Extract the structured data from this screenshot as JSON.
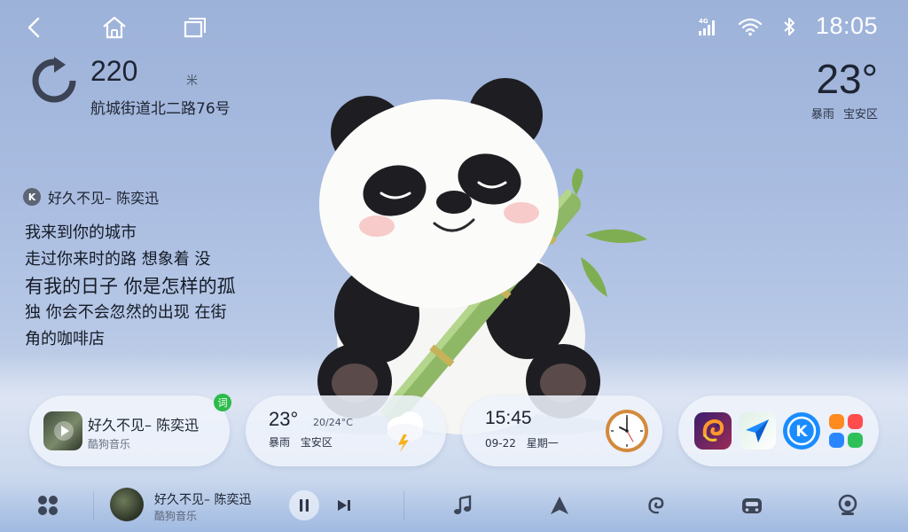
{
  "status": {
    "clock": "18:05",
    "network": "4G"
  },
  "navigation": {
    "distance": "220",
    "unit": "米",
    "road": "航城街道北二路76号"
  },
  "weather_top": {
    "temperature": "23°",
    "condition": "暴雨",
    "district": "宝安区"
  },
  "lyrics": {
    "badge": "K",
    "song_title": "好久不见– 陈奕迅",
    "lines": [
      "我来到你的城市",
      "走过你来时的路 想象着 没",
      "有我的日子 你是怎样的孤",
      "独 你会不会忽然的出现 在街",
      "角的咖啡店"
    ]
  },
  "cards": {
    "music": {
      "title": "好久不见– 陈奕迅",
      "app": "酷狗音乐",
      "lyric_badge": "词"
    },
    "weather": {
      "temperature": "23°",
      "range": "20/24°C",
      "condition": "暴雨",
      "district": "宝安区"
    },
    "time": {
      "time": "15:45",
      "date": "09-22",
      "weekday": "星期一"
    },
    "apps": [
      "chameleon-app-icon",
      "navigation-app-icon",
      "kugou-app-icon",
      "app-grid-icon"
    ]
  },
  "dock": {
    "song": "好久不见– 陈奕迅",
    "app": "酷狗音乐"
  },
  "colors": {
    "sky": "#a9bce0",
    "card_bg": "#eef2fa",
    "lyric_badge": "#2dbb4a",
    "kugou_blue": "#1a8cff"
  }
}
